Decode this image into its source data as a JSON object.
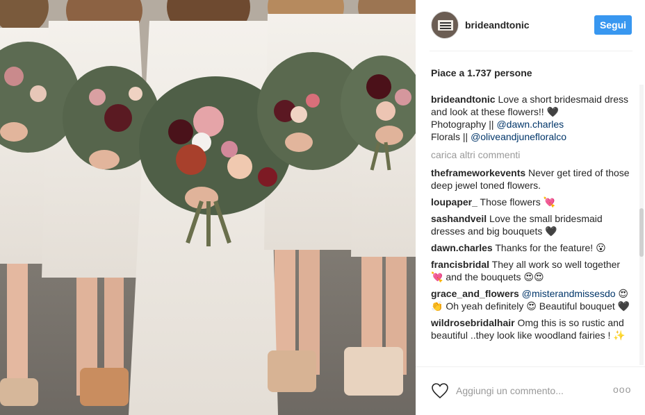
{
  "photo": {
    "alt": "Bridesmaids in white dresses holding bouquets"
  },
  "header": {
    "username": "brideandtonic",
    "follow_label": "Segui"
  },
  "likes": {
    "text": "Piace a 1.737 persone"
  },
  "caption": {
    "user": "brideandtonic",
    "text_line1": " Love a short bridesmaid dress and look at these flowers!! 🖤",
    "text_line2": " Photography || ",
    "mention1": "@dawn.charles",
    "text_line3": " Florals || ",
    "mention2": "@oliveandjunefloralco"
  },
  "load_more_label": "carica altri commenti",
  "comments": [
    {
      "user": "theframeworkevents",
      "text": " Never get tired of those deep jewel toned flowers."
    },
    {
      "user": "loupaper_",
      "text": " Those flowers 💘"
    },
    {
      "user": "sashandveil",
      "text": " Love the small bridesmaid dresses and big bouquets 🖤"
    },
    {
      "user": "dawn.charles",
      "text": " Thanks for the feature! 😮"
    },
    {
      "user": "francisbridal",
      "text": " They all work so well together 💘 and the bouquets 😍😍"
    },
    {
      "user": "grace_and_flowers",
      "mention": " @misterandmissesdo",
      "text": " 😍👏 Oh yeah definitely 😍 Beautiful bouquet 🖤"
    },
    {
      "user": "wildrosebridalhair",
      "text": " Omg this is so rustic and beautiful ..they look like woodland fairies ! ✨"
    }
  ],
  "footer": {
    "comment_placeholder": "Aggiungi un commento...",
    "more_label": "ooo",
    "like_icon": "heart-outline-icon"
  },
  "colors": {
    "accent": "#3897f0",
    "mention": "#003569",
    "muted": "#999999"
  }
}
